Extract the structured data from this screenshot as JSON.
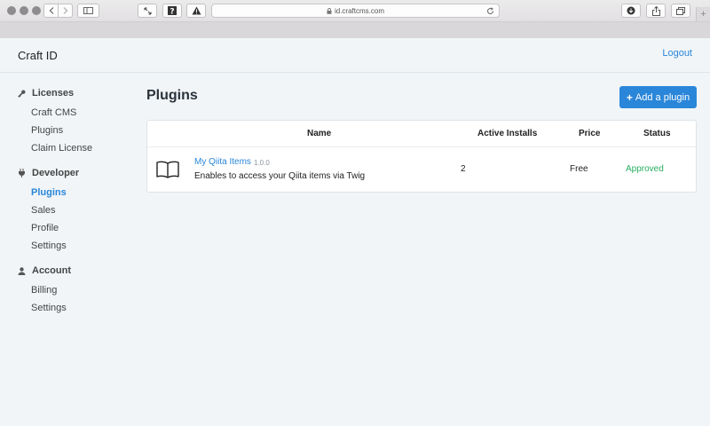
{
  "browser": {
    "url": "id.craftcms.com"
  },
  "header": {
    "brand": "Craft ID",
    "logout_label": "Logout"
  },
  "sidebar": {
    "groups": [
      {
        "label": "Licenses",
        "icon": "key-icon",
        "items": [
          "Craft CMS",
          "Plugins",
          "Claim License"
        ]
      },
      {
        "label": "Developer",
        "icon": "plug-icon",
        "items": [
          "Plugins",
          "Sales",
          "Profile",
          "Settings"
        ]
      },
      {
        "label": "Account",
        "icon": "user-icon",
        "items": [
          "Billing",
          "Settings"
        ]
      }
    ],
    "active": "Developer / Plugins"
  },
  "main": {
    "title": "Plugins",
    "add_button_label": "Add a plugin",
    "table": {
      "columns": [
        "Name",
        "Active Installs",
        "Price",
        "Status"
      ],
      "rows": [
        {
          "icon": "book-icon",
          "name": "My Qiita Items",
          "version": "1.0.0",
          "description": "Enables to access your Qiita items via Twig",
          "active_installs": "2",
          "price": "Free",
          "status": "Approved"
        }
      ]
    }
  },
  "colors": {
    "accent": "#2a86d9",
    "approved": "#27ae60",
    "background": "#f1f5f8"
  }
}
